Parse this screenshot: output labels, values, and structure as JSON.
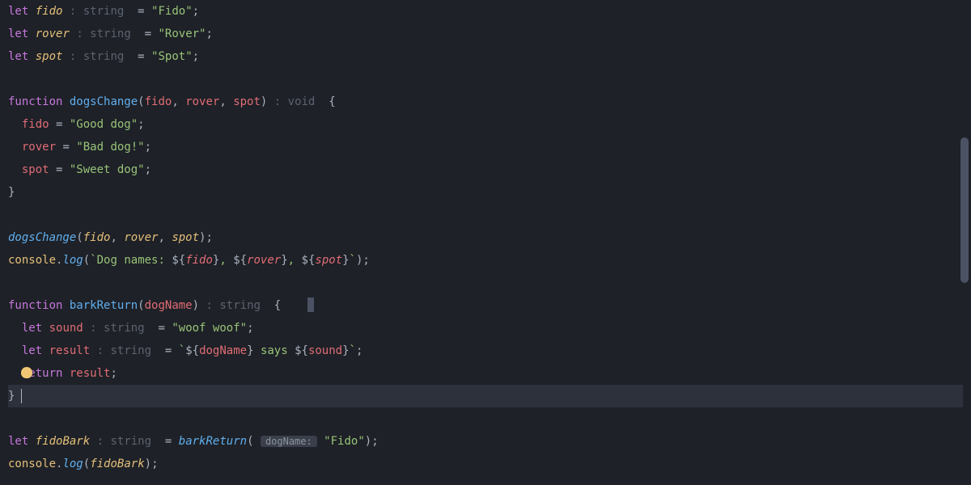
{
  "tokens": {
    "let": "let",
    "function": "function",
    "return": "return",
    "hint_string": " : string ",
    "hint_void": " : void ",
    "eq": " = ",
    "semi": ";",
    "comma": ", ",
    "lparen": "(",
    "rparen": ")",
    "lbrace": "{",
    "rbrace": "}",
    "dot": ".",
    "backtick": "`",
    "dollO": "${",
    "dollC": "}"
  },
  "vars": {
    "fido": "fido",
    "rover": "rover",
    "spot": "spot",
    "sound": "sound",
    "result": "result",
    "dogName": "dogName",
    "fidoBark": "fidoBark",
    "console": "console",
    "log": "log"
  },
  "fns": {
    "dogsChange": "dogsChange",
    "barkReturn": "barkReturn"
  },
  "strs": {
    "Fido": "\"Fido\"",
    "Rover": "\"Rover\"",
    "Spot": "\"Spot\"",
    "GoodDog": "\"Good dog\"",
    "BadDog": "\"Bad dog!\"",
    "SweetDog": "\"Sweet dog\"",
    "woof": "\"woof woof\"",
    "dogNamesPrefix": "Dog names: ",
    "says": " says ",
    "FidoArg": "\"Fido\""
  },
  "hints": {
    "dogNameBox": "dogName:"
  }
}
